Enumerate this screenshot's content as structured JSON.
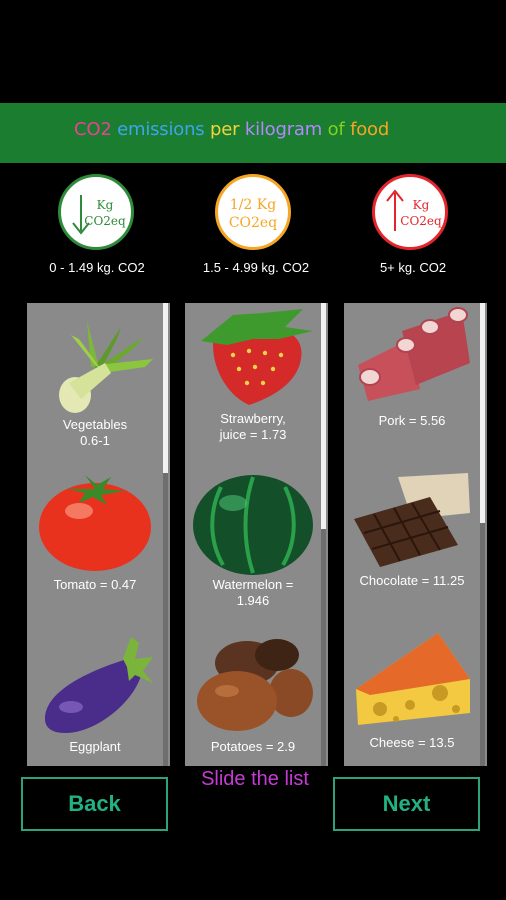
{
  "header": {
    "title_parts": [
      {
        "text": "CO2 ",
        "color": "#e84393"
      },
      {
        "text": "emissions ",
        "color": "#3da5f0"
      },
      {
        "text": "per ",
        "color": "#f0d43d"
      },
      {
        "text": "kilogram ",
        "color": "#b388ff"
      },
      {
        "text": "of ",
        "color": "#7ed321"
      },
      {
        "text": "food",
        "color": "#f5a623"
      }
    ]
  },
  "legend": [
    {
      "badge_line1": "Kg",
      "badge_line2": "CO2eq",
      "range": "0 - 1.49 kg. CO2",
      "color": "#2e8b3a",
      "arrow": "down"
    },
    {
      "badge_line1": "1/2 Kg",
      "badge_line2": "CO2eq",
      "range": "1.5 - 4.99 kg. CO2",
      "color": "#f5a623",
      "arrow": "none"
    },
    {
      "badge_line1": "Kg",
      "badge_line2": "CO2eq",
      "range": "5+ kg. CO2",
      "color": "#e3262b",
      "arrow": "up"
    }
  ],
  "columns": [
    {
      "items": [
        {
          "label": "Vegetables\n0.6-1",
          "icon": "leek-icon"
        },
        {
          "label": "Tomato = 0.47",
          "icon": "tomato-icon"
        },
        {
          "label": "Eggplant",
          "icon": "eggplant-icon"
        }
      ]
    },
    {
      "items": [
        {
          "label": "Strawberry,\njuice = 1.73",
          "icon": "strawberry-icon"
        },
        {
          "label": "Watermelon =\n1.946",
          "icon": "watermelon-icon"
        },
        {
          "label": "Potatoes = 2.9",
          "icon": "potatoes-icon"
        }
      ]
    },
    {
      "items": [
        {
          "label": "Pork = 5.56",
          "icon": "pork-ribs-icon"
        },
        {
          "label": "Chocolate = 11.25",
          "icon": "chocolate-icon"
        },
        {
          "label": "Cheese = 13.5",
          "icon": "cheese-icon"
        }
      ]
    }
  ],
  "footer": {
    "back_label": "Back",
    "next_label": "Next",
    "hint": "Slide the list"
  }
}
